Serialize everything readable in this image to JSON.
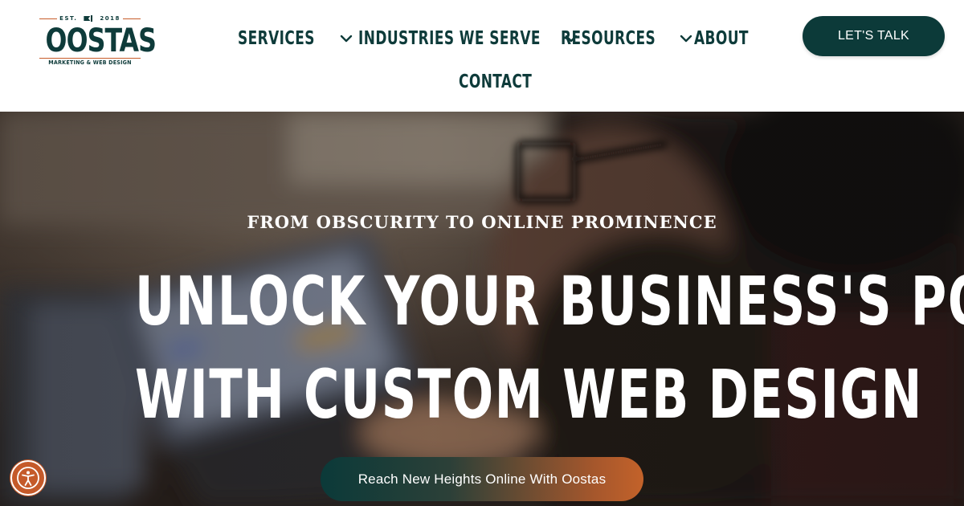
{
  "logo": {
    "est": "EST.",
    "year": "2018",
    "name": "OOSTAS",
    "tagline": "MARKETING & WEB DESIGN"
  },
  "nav": {
    "items": [
      {
        "label": "SERVICES",
        "has_dropdown": true
      },
      {
        "label": "INDUSTRIES WE SERVE",
        "has_dropdown": true
      },
      {
        "label": "RESOURCES",
        "has_dropdown": true
      },
      {
        "label": "ABOUT",
        "has_dropdown": false
      },
      {
        "label": "CONTACT",
        "has_dropdown": false
      }
    ],
    "cta_label": "LET'S TALK"
  },
  "hero": {
    "eyebrow": "FROM OBSCURITY TO ONLINE PROMINENCE",
    "title_line1": "UNLOCK YOUR BUSINESS'S POTENTIAL",
    "title_line2": "WITH CUSTOM WEB DESIGN",
    "cta_label": "Reach New Heights Online With Oostas"
  },
  "icons": {
    "chevron": "chevron-down-icon",
    "accessibility": "accessibility-icon",
    "flag": "flag-icon"
  },
  "colors": {
    "brand_teal": "#0c3a39",
    "brand_orange": "#c55a2a",
    "white": "#ffffff"
  }
}
